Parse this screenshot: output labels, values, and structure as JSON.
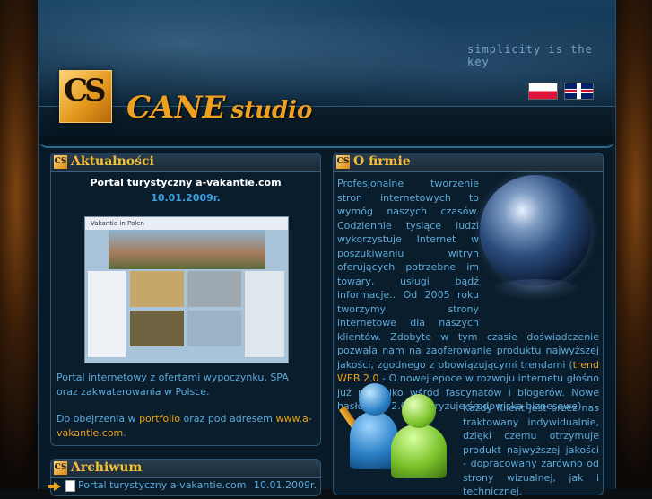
{
  "header": {
    "slogan": "simplicity is the key",
    "logo_text": "CS",
    "brand_main": "CANE",
    "brand_sub": "studio",
    "languages": [
      {
        "code": "pl",
        "icon": "flag-pl-icon"
      },
      {
        "code": "en",
        "icon": "flag-en-icon"
      }
    ]
  },
  "news": {
    "title": "Aktualności",
    "item_title": "Portal turystyczny a-vakantie.com",
    "item_date": "10.01.2009r.",
    "thumb_heading": "Vakantie in Polen",
    "para1": "Portal internetowy z ofertami wypoczynku, SPA oraz zakwaterowania w Polsce.",
    "para2_prefix": "Do obejrzenia w ",
    "para2_link1": "portfolio",
    "para2_mid": " oraz pod adresem ",
    "para2_link2": "www.a-vakantie.com",
    "para2_suffix": "."
  },
  "archive": {
    "title": "Archiwum",
    "items": [
      {
        "label": "Portal turystyczny a-vakantie.com",
        "date": "10.01.2009r."
      }
    ]
  },
  "company": {
    "title": "O firmie",
    "para1_a": "Profesjonalne tworzenie stron internetowych to wymóg naszych czasów. Codziennie tysiące ludzi wykorzystuje Internet w poszukiwaniu witryn oferujących potrzebne im towary, usługi bądź informacje.. Od 2005 roku tworzymy strony internetowe dla naszych klientów. Zdobyte w tym czasie doświadczenie pozwala nam na zaoferowanie produktu najwyższej jakości, zgodnego z obowiązującymi trendami (",
    "para1_link": "trend WEB 2.0",
    "para1_b": " - O nowej epoce w rozwoju internetu głośno już nie tylko wśród fascynatów i blogerów. Nowe hasło Web 2.0 elektryzuje środowiska biznesowe).",
    "para2": "Każdy Klient jest przez nas traktowany indywidualnie, dzięki czemu otrzymuje produkt najwyższej jakości - dopracowany zarówno od strony wizualnej, jak i technicznej."
  },
  "colors": {
    "accent": "#f4c035",
    "text": "#5ea9d8",
    "link": "#e8a21a",
    "background": "#081a28"
  }
}
